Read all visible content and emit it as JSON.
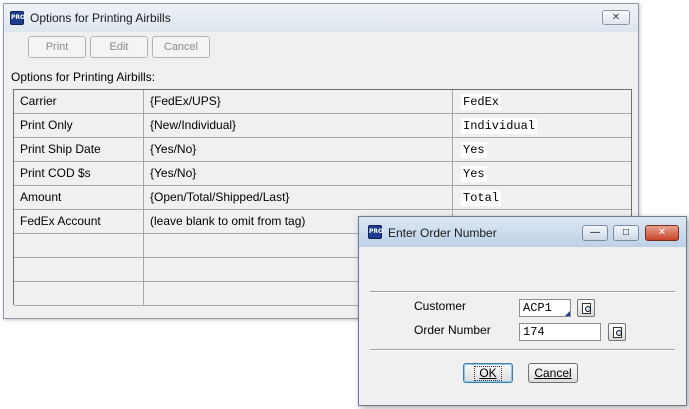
{
  "main_window": {
    "app_icon": "PRO",
    "title": "Options for Printing Airbills",
    "close_icon": "✕",
    "toolbar": {
      "print": "Print",
      "edit": "Edit",
      "cancel": "Cancel"
    },
    "section_label": "Options for Printing Airbills:",
    "rows": [
      {
        "name": "Carrier",
        "options": "{FedEx/UPS}",
        "value": "FedEx"
      },
      {
        "name": "Print Only",
        "options": "{New/Individual}",
        "value": "Individual"
      },
      {
        "name": "Print Ship Date",
        "options": "{Yes/No}",
        "value": "Yes"
      },
      {
        "name": "Print COD $s",
        "options": "{Yes/No}",
        "value": "Yes"
      },
      {
        "name": "Amount",
        "options": "{Open/Total/Shipped/Last}",
        "value": "Total"
      },
      {
        "name": "FedEx Account",
        "options": "(leave blank to omit from tag)",
        "value": ""
      }
    ]
  },
  "dialog": {
    "app_icon": "PRO",
    "title": "Enter Order Number",
    "customer_label": "Customer",
    "customer_value": "ACP1",
    "order_label": "Order Number",
    "order_value": "174",
    "ok_label": "OK",
    "cancel_label": "Cancel"
  },
  "colors": {
    "window_bg": "#f0f0f0",
    "dialog_close": "#c8442a",
    "app_icon": "#1e3d8f"
  }
}
